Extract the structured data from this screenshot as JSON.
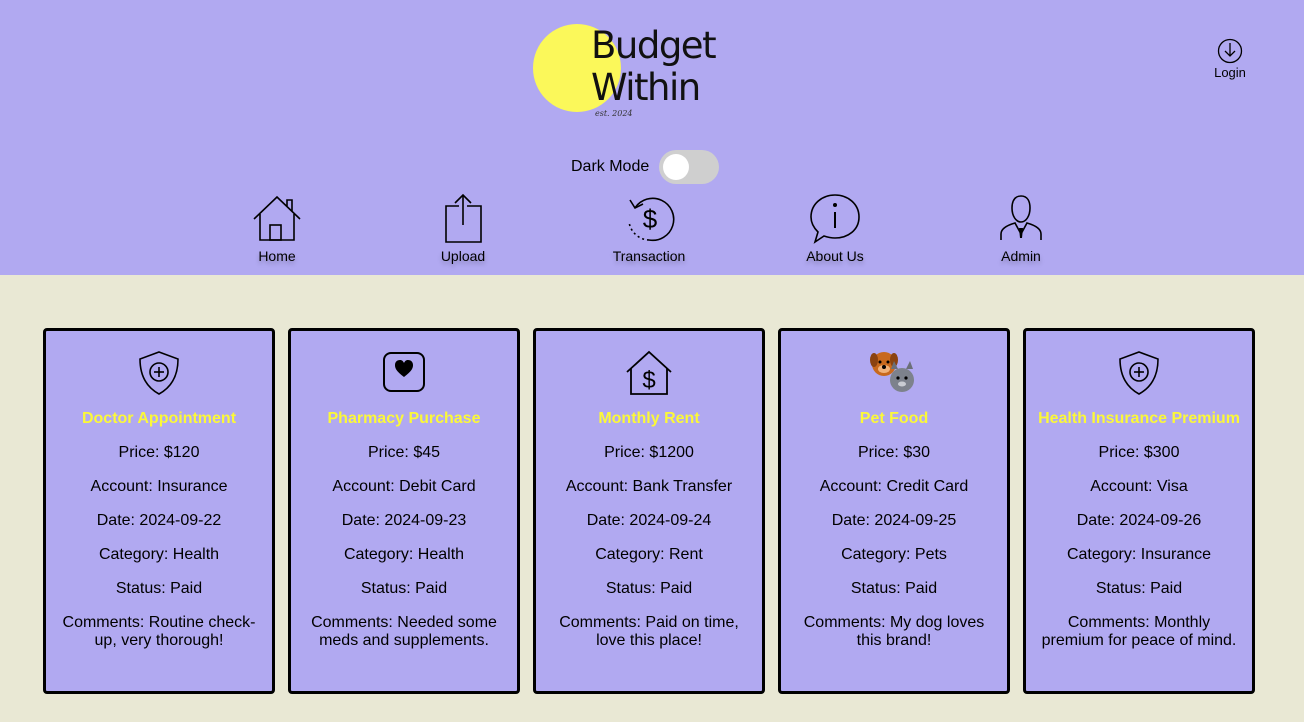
{
  "header": {
    "logo": {
      "line1": "Budget",
      "line2": "Within",
      "est": "est. 2024"
    },
    "login_label": "Login",
    "dark_mode_label": "Dark Mode",
    "dark_mode_on": false,
    "nav": [
      {
        "label": "Home",
        "icon": "home-icon"
      },
      {
        "label": "Upload",
        "icon": "upload-icon"
      },
      {
        "label": "Transaction",
        "icon": "transaction-icon"
      },
      {
        "label": "About Us",
        "icon": "info-icon"
      },
      {
        "label": "Admin",
        "icon": "admin-icon"
      }
    ]
  },
  "cards": [
    {
      "icon": "shield-plus-icon",
      "title": "Doctor Appointment",
      "price": "Price: $120",
      "account": "Account: Insurance",
      "date": "Date: 2024-09-22",
      "category": "Category: Health",
      "status": "Status: Paid",
      "comments": "Comments: Routine check-up, very thorough!"
    },
    {
      "icon": "heart-square-icon",
      "title": "Pharmacy Purchase",
      "price": "Price: $45",
      "account": "Account: Debit Card",
      "date": "Date: 2024-09-23",
      "category": "Category: Health",
      "status": "Status: Paid",
      "comments": "Comments: Needed some meds and supplements."
    },
    {
      "icon": "house-dollar-icon",
      "title": "Monthly Rent",
      "price": "Price: $1200",
      "account": "Account: Bank Transfer",
      "date": "Date: 2024-09-24",
      "category": "Category: Rent",
      "status": "Status: Paid",
      "comments": "Comments: Paid on time, love this place!"
    },
    {
      "icon": "dog-cat-icon",
      "title": "Pet Food",
      "price": "Price: $30",
      "account": "Account: Credit Card",
      "date": "Date: 2024-09-25",
      "category": "Category: Pets",
      "status": "Status: Paid",
      "comments": "Comments: My dog loves this brand!"
    },
    {
      "icon": "shield-plus-icon",
      "title": "Health Insurance Premium",
      "price": "Price: $300",
      "account": "Account: Visa",
      "date": "Date: 2024-09-26",
      "category": "Category: Insurance",
      "status": "Status: Paid",
      "comments": "Comments: Monthly premium for peace of mind."
    }
  ],
  "colors": {
    "header_bg": "#b1a9f1",
    "page_bg": "#e9e8d4",
    "card_title": "#fbf839",
    "logo_sun": "#fbf85a"
  }
}
